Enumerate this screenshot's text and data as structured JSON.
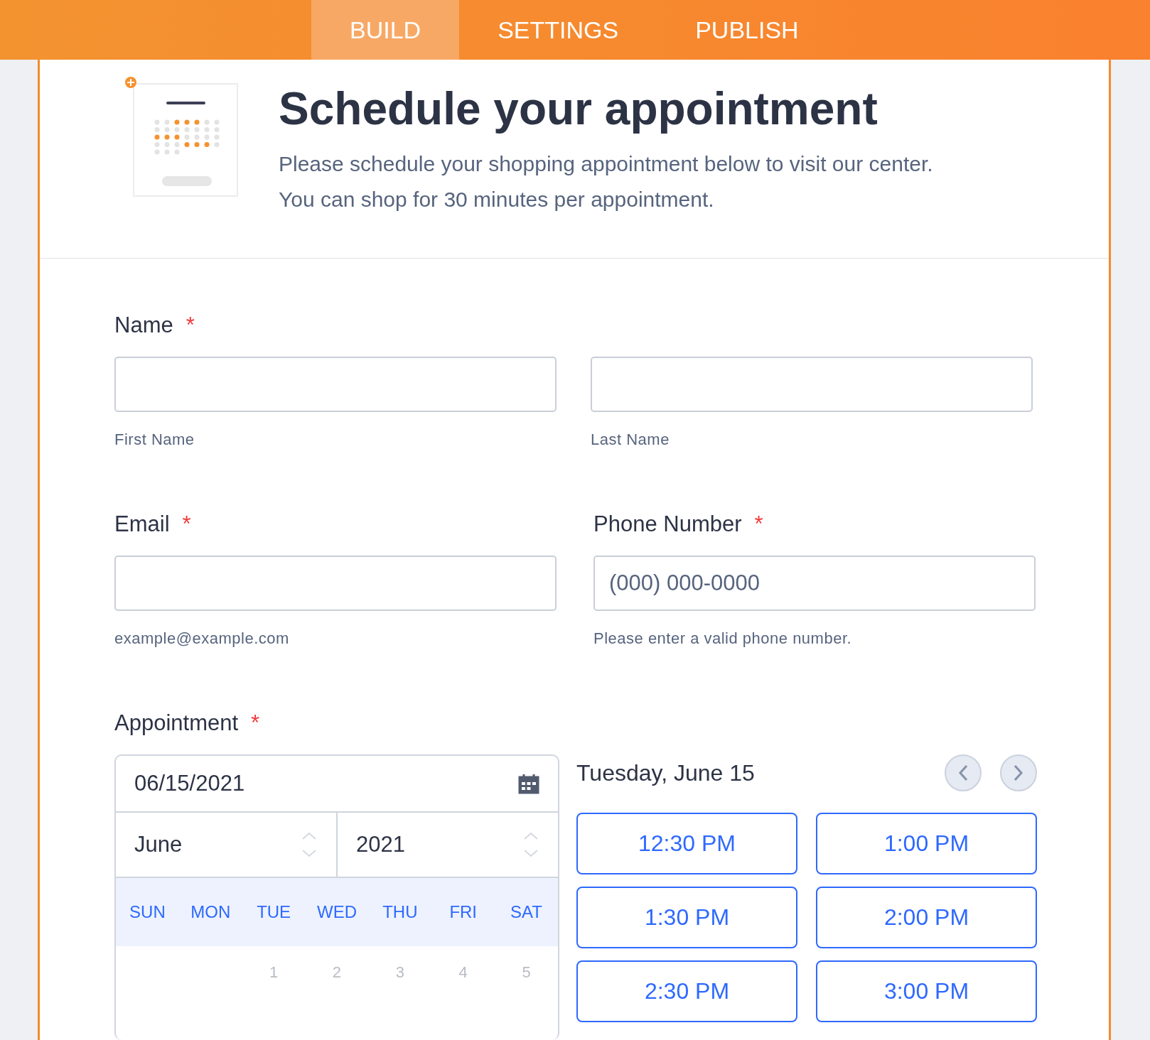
{
  "tabs": [
    {
      "label": "BUILD",
      "selected": true
    },
    {
      "label": "SETTINGS",
      "selected": false
    },
    {
      "label": "PUBLISH",
      "selected": false
    }
  ],
  "header": {
    "title": "Schedule your appointment",
    "description": "Please schedule your shopping appointment below to visit our center. You can shop for 30 minutes per appointment."
  },
  "name": {
    "label": "Name",
    "required_mark": "*",
    "inputs": [
      {
        "sublabel": "First Name"
      },
      {
        "sublabel": "Last Name"
      }
    ]
  },
  "email": {
    "label": "Email",
    "required_mark": "*",
    "sublabel": "example@example.com"
  },
  "phone": {
    "label": "Phone Number",
    "required_mark": "*",
    "placeholder": "(000) 000-0000",
    "sublabel": "Please enter a valid phone number."
  },
  "appointment": {
    "label": "Appointment",
    "required_mark": "*",
    "date_value": "06/15/2021",
    "month": "June",
    "year": "2021",
    "weekdays": [
      "SUN",
      "MON",
      "TUE",
      "WED",
      "THU",
      "FRI",
      "SAT"
    ],
    "days": [
      "1",
      "2",
      "3",
      "4",
      "5"
    ],
    "day_heading": "Tuesday, June 15",
    "slots": [
      "12:30 PM",
      "1:00 PM",
      "1:30 PM",
      "2:00 PM",
      "2:30 PM",
      "3:00 PM"
    ]
  }
}
